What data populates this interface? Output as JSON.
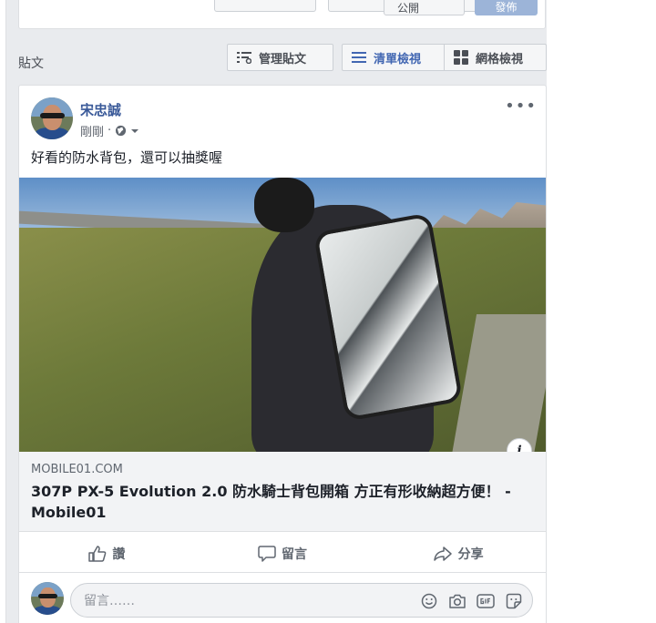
{
  "top_card": {
    "stub_left_label": "公開",
    "stub_right_label": "發佈"
  },
  "posts_bar": {
    "title": "貼文",
    "manage_label": "管理貼文",
    "list_view_label": "清單檢視",
    "grid_view_label": "網格檢視"
  },
  "post": {
    "author": "宋忠誠",
    "time": "剛剛",
    "separator": "·",
    "text": "好看的防水背包，還可以抽獎喔",
    "link": {
      "domain": "MOBILE01.COM",
      "title": "307P PX-5 Evolution 2.0 防水騎士背包開箱 方正有形收納超方便！ - Mobile01"
    },
    "actions": {
      "like": "讚",
      "comment": "留言",
      "share": "分享"
    },
    "comment_placeholder": "留言……",
    "info_label": "i"
  }
}
